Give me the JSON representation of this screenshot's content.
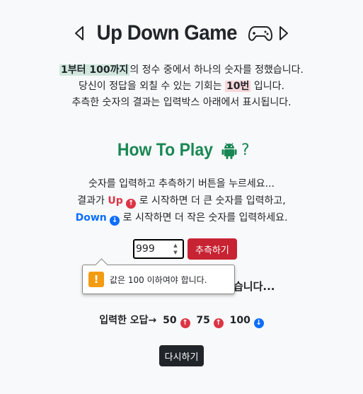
{
  "header": {
    "title": "Up Down Game",
    "left_icon": "caret-left-icon",
    "right_icon": "caret-right-icon",
    "game_icon": "controller-icon"
  },
  "intro": {
    "range_text": "1부터 100까지",
    "line1_rest": "의 정수 중에서 하나의 숫자를 정했습니다.",
    "line2_pre": "당신이 정답을 외칠 수 있는 기회는 ",
    "chances": "10번",
    "line2_post": " 입니다.",
    "line3": "추측한 숫자의 결과는 입력박스 아래에서 표시됩니다."
  },
  "howto": {
    "title": "How To Play",
    "icon": "android-icon",
    "question": "?"
  },
  "rules": {
    "line1": "숫자를 입력하고 추측하기 버튼을 누르세요...",
    "line2_pre": "결과가 ",
    "up_label": "Up",
    "line2_post": " 로 시작하면 더 큰 숫자를 입력하고,",
    "down_label": "Down",
    "line3_post": " 로 시작하면 더 작은 숫자를 입력하세요."
  },
  "form": {
    "input_value": "999",
    "guess_label": "추측하기"
  },
  "tooltip": {
    "message": "값은 100 이하여야 합니다."
  },
  "result_text": "습니다...",
  "wrong_answers": {
    "label": "입력한 오답→",
    "items": [
      {
        "value": "50",
        "direction": "up"
      },
      {
        "value": "75",
        "direction": "up"
      },
      {
        "value": "100",
        "direction": "down"
      }
    ]
  },
  "retry_label": "다시하기",
  "colors": {
    "up": "#dc3545",
    "down": "#0d6efd",
    "green": "#198754",
    "button_red": "#c82333",
    "button_dark": "#212529"
  }
}
